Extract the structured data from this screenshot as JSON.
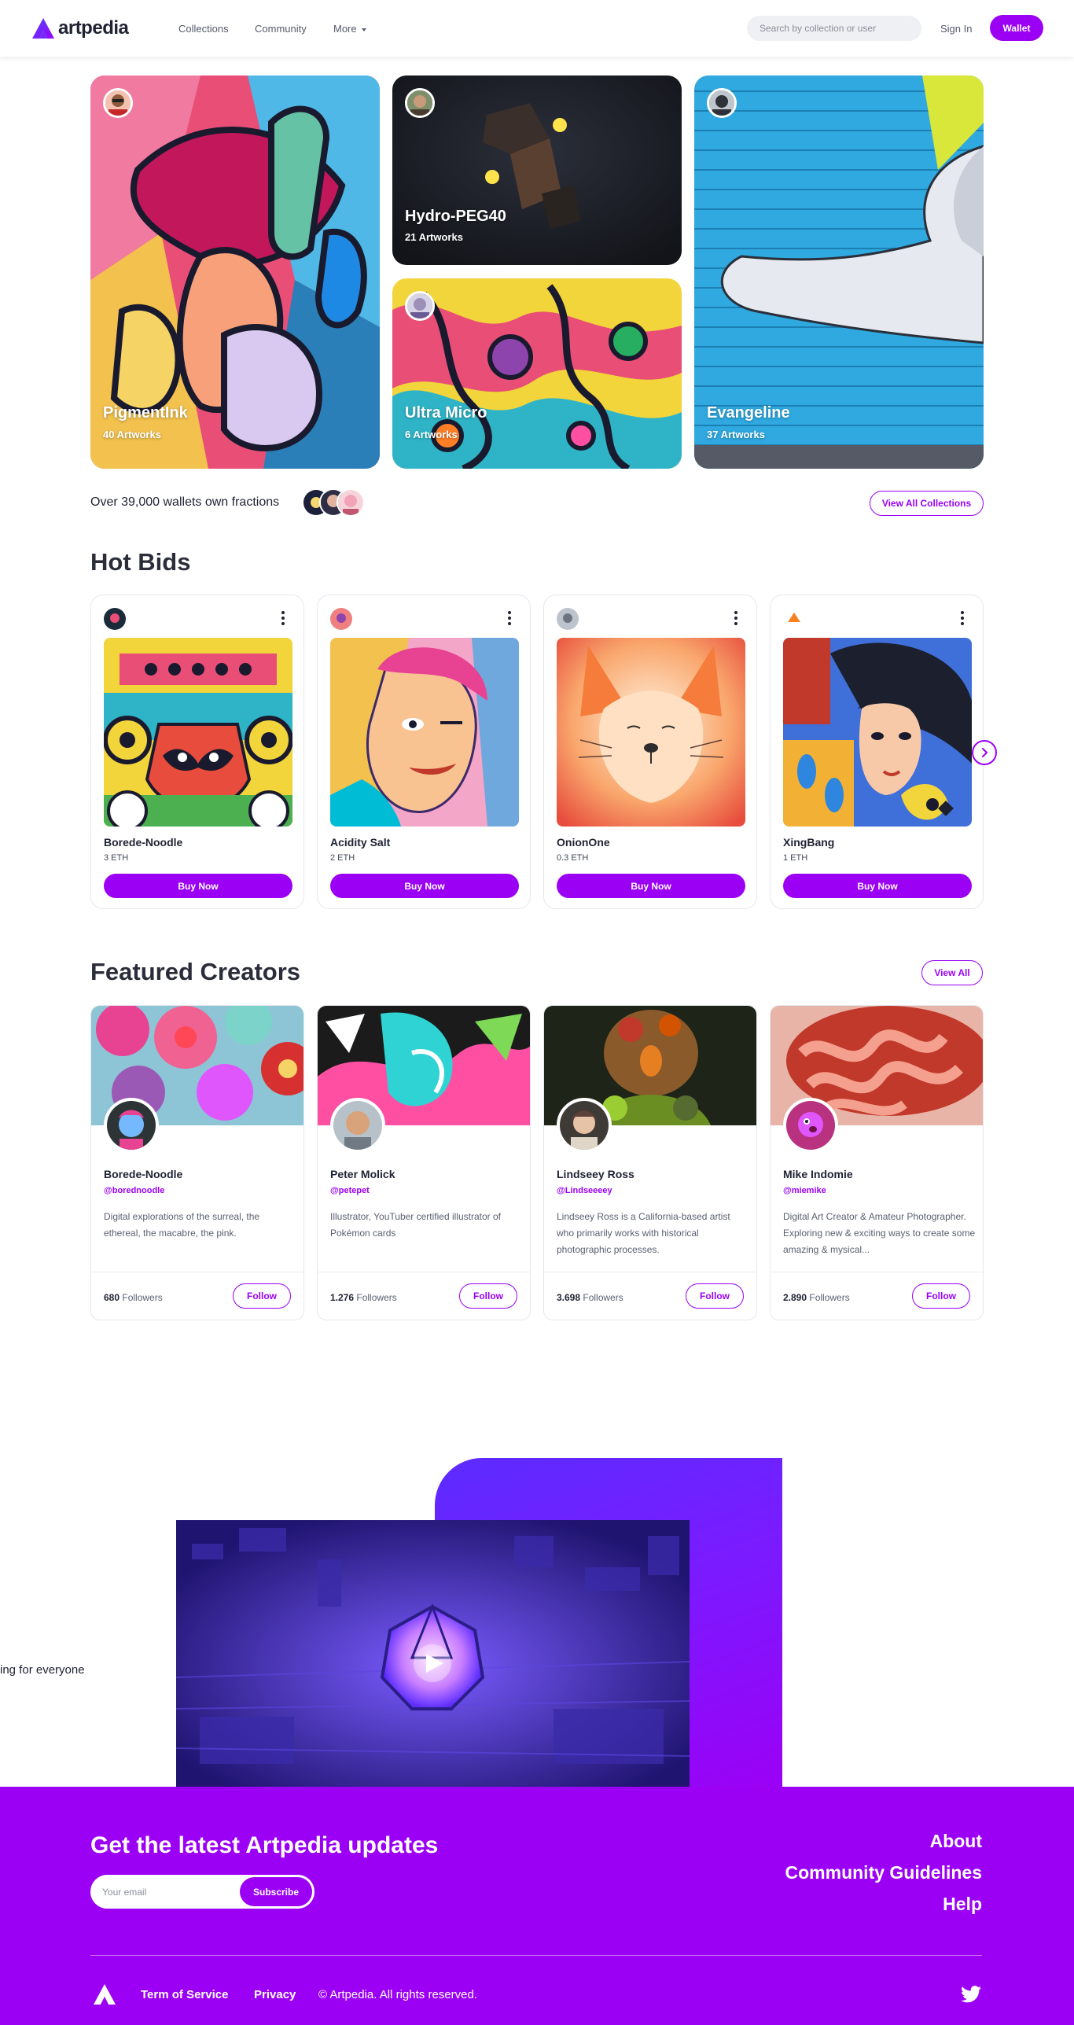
{
  "nav": {
    "logo_text": "artpedia",
    "links": [
      "Collections",
      "Community",
      "More"
    ],
    "search_placeholder": "Search by collection or user",
    "signin_label": "Sign In",
    "wallet_label": "Wallet"
  },
  "collections": [
    {
      "title": "PigmentInk",
      "count": "40 Artworks"
    },
    {
      "title": "Hydro-PEG40",
      "count": "21 Artworks"
    },
    {
      "title": "Ultra Micro",
      "count": "6 Artworks"
    },
    {
      "title": "Evangeline",
      "count": "37 Artworks"
    }
  ],
  "wallets_text": "Over 39,000 wallets own fractions",
  "view_all_collections_label": "View All Collections",
  "hot_bids": {
    "title": "Hot Bids",
    "buy_label": "Buy Now",
    "items": [
      {
        "name": "Borede-Noodle",
        "price": "3 ETH"
      },
      {
        "name": "Acidity Salt",
        "price": "2 ETH"
      },
      {
        "name": "OnionOne",
        "price": "0.3 ETH"
      },
      {
        "name": "XingBang",
        "price": "1 ETH"
      }
    ]
  },
  "featured": {
    "title": "Featured Creators",
    "view_all_label": "View All",
    "follow_label": "Follow",
    "followers_word": "Followers",
    "creators": [
      {
        "name": "Borede-Noodle",
        "handle": "@borednoodle",
        "bio": "Digital explorations of the surreal, the ethereal, the macabre, the pink.",
        "followers": "680"
      },
      {
        "name": "Peter Molick",
        "handle": "@petepet",
        "bio": "Illustrator, YouTuber certified illustrator of Pokémon cards",
        "followers": "1.276"
      },
      {
        "name": "Lindseey Ross",
        "handle": "@Lindseeeey",
        "bio": "Lindseey Ross is a California-based artist who primarily works with historical photographic processes.",
        "followers": "3.698"
      },
      {
        "name": "Mike Indomie",
        "handle": "@miemike",
        "bio": "Digital Art Creator & Amateur Photographer. Exploring new & exciting ways to create some amazing & mysical...",
        "followers": "2.890"
      }
    ]
  },
  "video_section": {
    "side_text": "ing for everyone"
  },
  "footer": {
    "title": "Get the latest Artpedia updates",
    "email_placeholder": "Your email",
    "subscribe_label": "Subscribe",
    "links": [
      "About",
      "Community Guidelines",
      "Help"
    ],
    "terms_label": "Term of Service",
    "privacy_label": "Privacy",
    "copyright": "© Artpedia. All rights reserved."
  },
  "colors": {
    "accent": "#9b00f5",
    "text": "#1f2233"
  },
  "icons": [
    "logo-icon",
    "chevron-down-icon",
    "more-vertical-icon",
    "chevron-right-icon",
    "play-icon",
    "twitter-icon"
  ]
}
